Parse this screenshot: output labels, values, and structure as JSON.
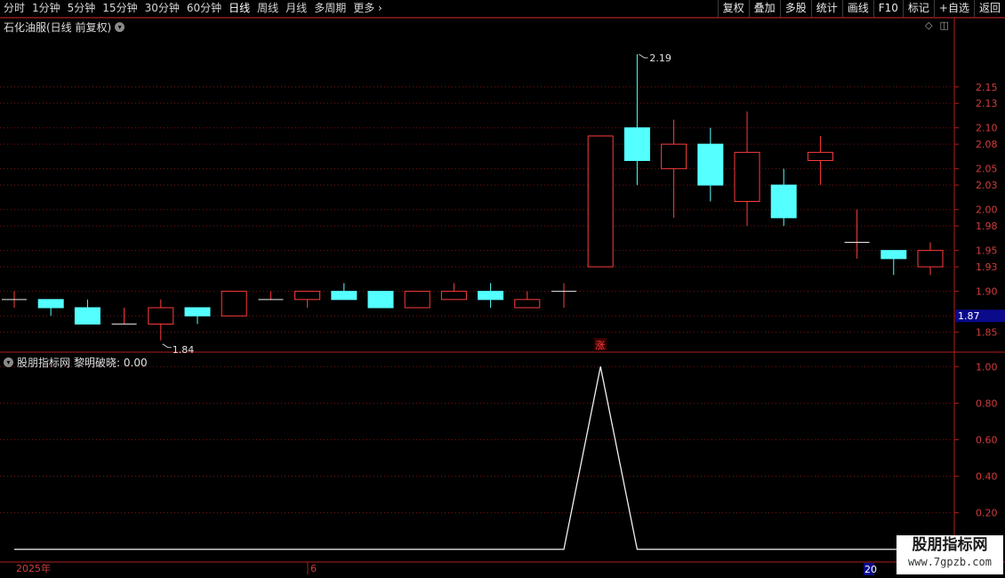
{
  "toolbar": {
    "periods": [
      "分时",
      "1分钟",
      "5分钟",
      "15分钟",
      "30分钟",
      "60分钟",
      "日线",
      "周线",
      "月线",
      "多周期",
      "更多"
    ],
    "active_period": "日线",
    "more_arrow": "›",
    "buttons": [
      "复权",
      "叠加",
      "多股",
      "统计",
      "画线",
      "F10",
      "标记",
      "+自选",
      "返回"
    ]
  },
  "chart": {
    "title": "石化油服(日线 前复权)",
    "current_price_label": "1.87",
    "high_label": "2.19",
    "low_label": "1.84",
    "signal_label": "涨",
    "up_color": "#ff3c3c",
    "down_color": "#54ffff"
  },
  "indicator": {
    "name": "股朋指标网",
    "series_label": "黎明破晓: 0.00"
  },
  "date_axis": {
    "labels": [
      "2025年",
      "6",
      "20"
    ]
  },
  "watermark": {
    "name": "股朋指标网",
    "url": "www.7gpzb.com"
  },
  "chart_data": {
    "type": "candlestick",
    "title": "石化油服(日线 前复权)",
    "y_ticks": [
      2.15,
      2.13,
      2.1,
      2.08,
      2.05,
      2.03,
      2.0,
      1.98,
      1.95,
      1.93,
      1.9,
      1.87,
      1.85
    ],
    "ylim": [
      1.83,
      2.215
    ],
    "candles": [
      {
        "open": 1.89,
        "high": 1.9,
        "low": 1.88,
        "close": 1.89
      },
      {
        "open": 1.89,
        "high": 1.89,
        "low": 1.87,
        "close": 1.88
      },
      {
        "open": 1.88,
        "high": 1.89,
        "low": 1.86,
        "close": 1.86
      },
      {
        "open": 1.86,
        "high": 1.88,
        "low": 1.86,
        "close": 1.86
      },
      {
        "open": 1.86,
        "high": 1.89,
        "low": 1.84,
        "close": 1.88
      },
      {
        "open": 1.88,
        "high": 1.88,
        "low": 1.86,
        "close": 1.87
      },
      {
        "open": 1.87,
        "high": 1.9,
        "low": 1.87,
        "close": 1.9
      },
      {
        "open": 1.89,
        "high": 1.9,
        "low": 1.89,
        "close": 1.89
      },
      {
        "open": 1.89,
        "high": 1.89,
        "low": 1.88,
        "close": 1.9
      },
      {
        "open": 1.9,
        "high": 1.91,
        "low": 1.9,
        "close": 1.89
      },
      {
        "open": 1.9,
        "high": 1.9,
        "low": 1.88,
        "close": 1.88
      },
      {
        "open": 1.88,
        "high": 1.89,
        "low": 1.88,
        "close": 1.9
      },
      {
        "open": 1.89,
        "high": 1.91,
        "low": 1.89,
        "close": 1.9
      },
      {
        "open": 1.9,
        "high": 1.91,
        "low": 1.88,
        "close": 1.89
      },
      {
        "open": 1.88,
        "high": 1.9,
        "low": 1.88,
        "close": 1.89
      },
      {
        "open": 1.9,
        "high": 1.91,
        "low": 1.88,
        "close": 1.9
      },
      {
        "open": 1.93,
        "high": 2.09,
        "low": 1.93,
        "close": 2.09
      },
      {
        "open": 2.1,
        "high": 2.19,
        "low": 2.03,
        "close": 2.06
      },
      {
        "open": 2.05,
        "high": 2.11,
        "low": 1.99,
        "close": 2.08
      },
      {
        "open": 2.08,
        "high": 2.1,
        "low": 2.01,
        "close": 2.03
      },
      {
        "open": 2.01,
        "high": 2.12,
        "low": 1.98,
        "close": 2.07
      },
      {
        "open": 2.03,
        "high": 2.05,
        "low": 1.98,
        "close": 1.99
      },
      {
        "open": 2.06,
        "high": 2.09,
        "low": 2.03,
        "close": 2.07
      },
      {
        "open": 1.96,
        "high": 2.0,
        "low": 1.94,
        "close": 1.96
      },
      {
        "open": 1.95,
        "high": 1.95,
        "low": 1.92,
        "close": 1.94
      },
      {
        "open": 1.93,
        "high": 1.96,
        "low": 1.92,
        "close": 1.95
      }
    ],
    "indicator": {
      "name": "黎明破晓",
      "y_ticks": [
        1.0,
        0.8,
        0.6,
        0.4,
        0.2
      ],
      "ylim": [
        -0.05,
        1.05
      ],
      "values": [
        0,
        0,
        0,
        0,
        0,
        0,
        0,
        0,
        0,
        0,
        0,
        0,
        0,
        0,
        0,
        0,
        1,
        0,
        0,
        0,
        0,
        0,
        0,
        0,
        0,
        0
      ]
    }
  }
}
